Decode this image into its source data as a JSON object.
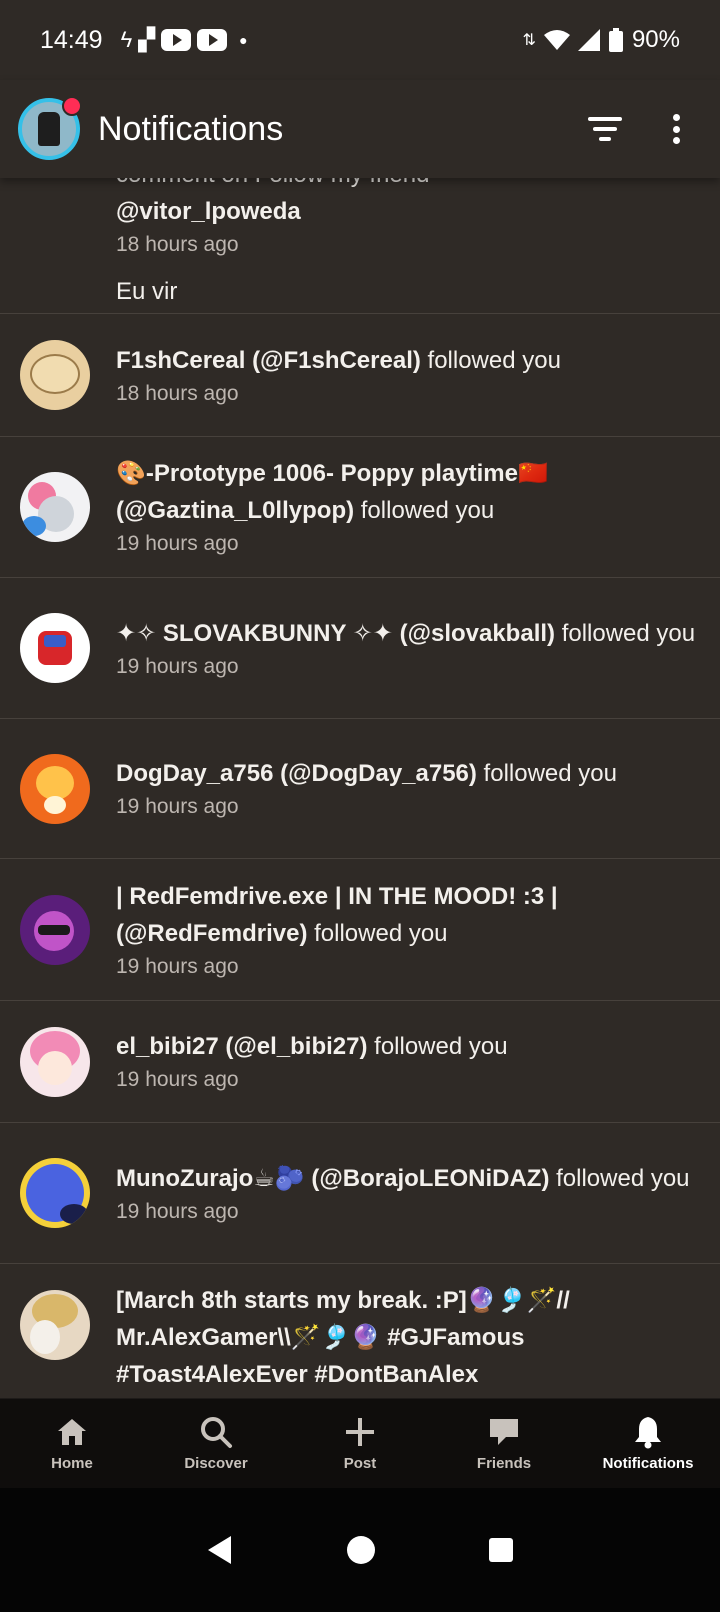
{
  "status_bar": {
    "time": "14:49",
    "battery": "90%"
  },
  "header": {
    "title": "Notifications"
  },
  "notifications": [
    {
      "partial_text": "comment on Follow my friend",
      "handle": "@vitor_lpoweda",
      "time": "18 hours ago",
      "comment": "Eu vir"
    },
    {
      "name": "F1shCereal (@F1shCereal)",
      "action": " followed you",
      "time": "18 hours ago"
    },
    {
      "name": "🎨-Prototype 1006- Poppy playtime🇨🇳 (@Gaztina_L0llypop)",
      "action": " followed you",
      "time": "19 hours ago"
    },
    {
      "name": "✦✧ SLOVAKBUNNY ✧✦ (@slovakball)",
      "action": " followed you",
      "time": "19 hours ago"
    },
    {
      "name": "DogDay_a756 (@DogDay_a756)",
      "action": " followed you",
      "time": "19 hours ago"
    },
    {
      "name": "| RedFemdrive.exe | IN THE MOOD! :3 | (@RedFemdrive)",
      "action": " followed you",
      "time": "19 hours ago"
    },
    {
      "name": "el_bibi27 (@el_bibi27)",
      "action": " followed you",
      "time": "19 hours ago"
    },
    {
      "name": "MunoZurajo☕🫐 (@BorajoLEONiDAZ)",
      "action": " followed you",
      "time": "19 hours ago"
    },
    {
      "name": "[March 8th starts my break. :P]🔮🎐🪄// Mr.AlexGamer\\\\🪄🎐🔮 #GJFamous #Toast4AlexEver #DontBanAlex"
    }
  ],
  "bottom_nav": {
    "home": "Home",
    "discover": "Discover",
    "post": "Post",
    "friends": "Friends",
    "notifications": "Notifications"
  }
}
